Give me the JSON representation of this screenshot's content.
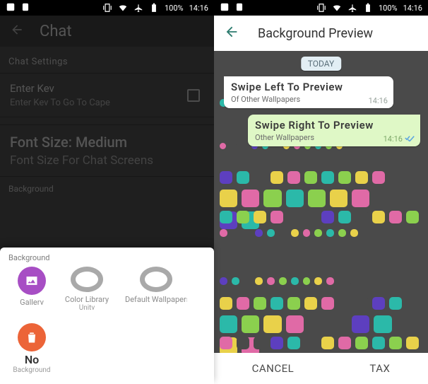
{
  "status": {
    "battery": "100%",
    "time": "14:16"
  },
  "left": {
    "appbar_title": "Chat",
    "section_header": "Chat Settings",
    "enter_key": {
      "title": "Enter Kev",
      "sub": "Enter Kev To Go To Cape"
    },
    "font_size": {
      "title": "Font Size: Medium",
      "sub": "Font Size For Chat Screens"
    },
    "background_header": "Background",
    "sheet": {
      "title": "Background",
      "gallery": "Gallerv",
      "color_library": "Color Library",
      "color_library_sub": "Unitv",
      "default_wallpapers": "Default Wallpapers",
      "no": "No",
      "no_sub": "Background"
    }
  },
  "right": {
    "appbar_title": "Background Preview",
    "date": "TODAY",
    "bubble_in": {
      "t1": "Swipe Left To Preview",
      "t2": "Of Other Wallpapers",
      "time": "14:16"
    },
    "bubble_out": {
      "t1": "Swipe Right To Preview",
      "t2": "Other Wallpapers",
      "time": "14:16"
    },
    "cancel": "CANCEL",
    "set": "TAX"
  },
  "wp_colors": [
    "#2bb9a9",
    "#8bd04e",
    "#e9d14a",
    "#e06aa6",
    "#4a4a4a",
    "#4a4a4a",
    "#5d3fbf",
    "#2bb9a9",
    "#4a4a4a",
    "#e9d14a",
    "#e06aa6",
    "#8bd04e"
  ]
}
